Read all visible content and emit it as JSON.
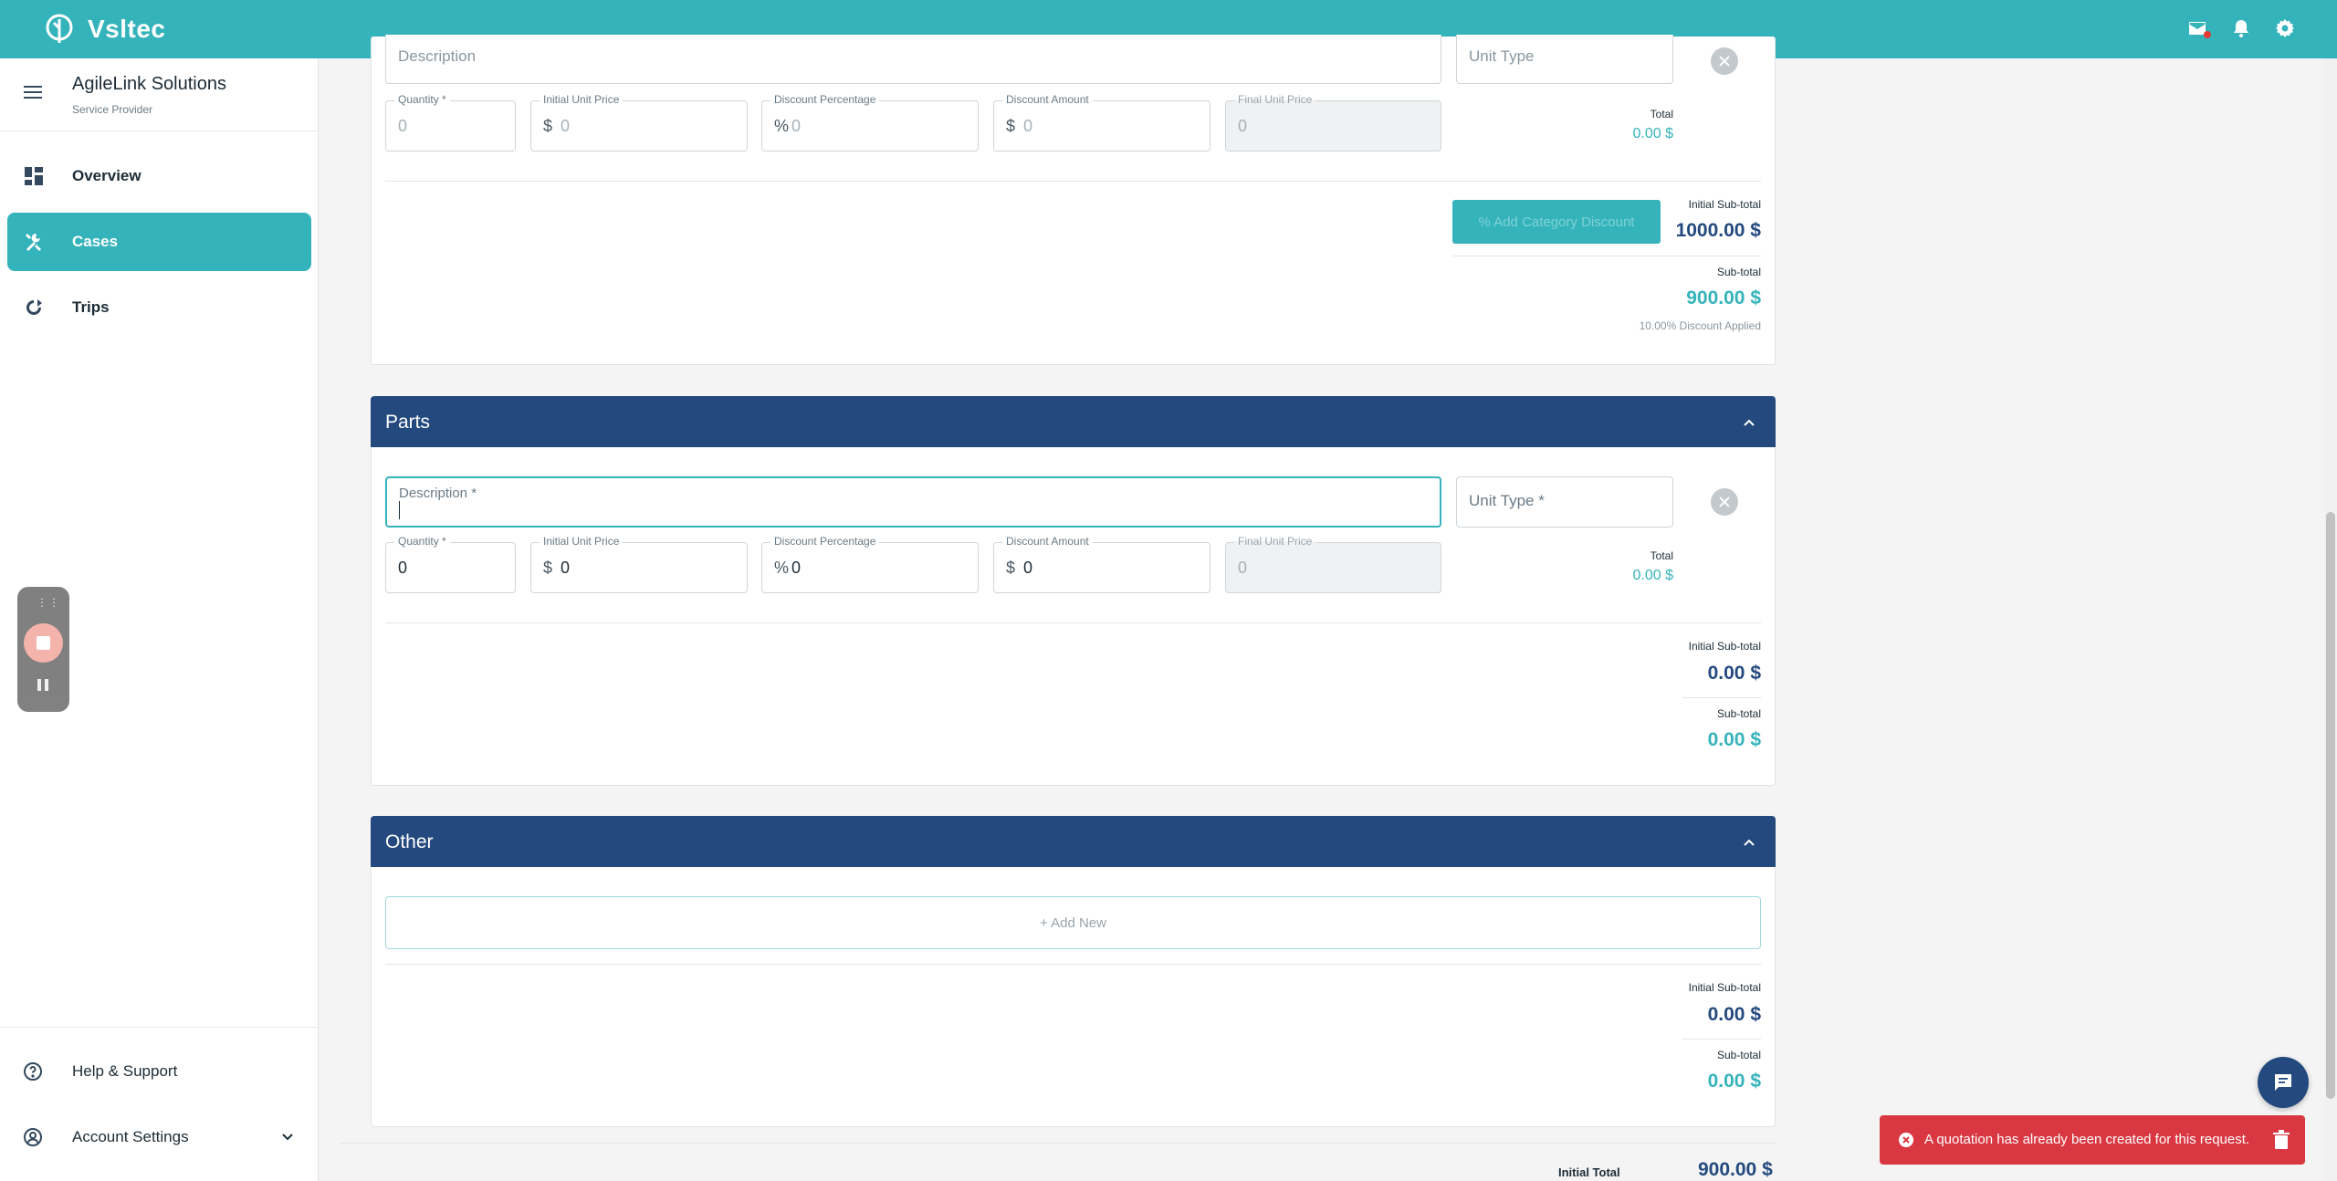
{
  "app": {
    "brand": "Vsltec"
  },
  "topbar": {
    "icons": [
      "mail-icon",
      "bell-icon",
      "gear-icon"
    ],
    "accent": "#35b3bb"
  },
  "sidebar": {
    "org_name": "AgileLink Solutions",
    "org_type": "Service Provider",
    "items": [
      {
        "label": "Overview",
        "icon": "dashboard-icon",
        "active": false
      },
      {
        "label": "Cases",
        "icon": "tools-icon",
        "active": true
      },
      {
        "label": "Trips",
        "icon": "route-icon",
        "active": false
      }
    ],
    "bottom": [
      {
        "label": "Help & Support",
        "icon": "help-icon"
      },
      {
        "label": "Account Settings",
        "icon": "account-icon"
      }
    ]
  },
  "labor": {
    "description_label": "Description",
    "unit_type_label": "Unit Type",
    "quantity_label": "Quantity *",
    "quantity_value": "0",
    "initial_unit_price_label": "Initial Unit Price",
    "initial_unit_price_value": "0",
    "discount_percentage_label": "Discount Percentage",
    "discount_percentage_value": "0",
    "discount_amount_label": "Discount Amount",
    "discount_amount_value": "0",
    "final_unit_price_label": "Final Unit Price",
    "final_unit_price_value": "0",
    "total_label": "Total",
    "total_value": "0.00 $",
    "category_discount_button": "% Add Category Discount",
    "initial_subtotal_label": "Initial Sub-total",
    "initial_subtotal_value": "1000.00 $",
    "subtotal_label": "Sub-total",
    "subtotal_value": "900.00 $",
    "discount_note": "10.00% Discount Applied"
  },
  "parts": {
    "title": "Parts",
    "description_label": "Description *",
    "unit_type_label": "Unit Type *",
    "quantity_label": "Quantity *",
    "quantity_value": "0",
    "initial_unit_price_label": "Initial Unit Price",
    "initial_unit_price_value": "0",
    "discount_percentage_label": "Discount Percentage",
    "discount_percentage_value": "0",
    "discount_amount_label": "Discount Amount",
    "discount_amount_value": "0",
    "final_unit_price_label": "Final Unit Price",
    "final_unit_price_value": "0",
    "total_label": "Total",
    "total_value": "0.00 $",
    "initial_subtotal_label": "Initial Sub-total",
    "initial_subtotal_value": "0.00 $",
    "subtotal_label": "Sub-total",
    "subtotal_value": "0.00 $"
  },
  "other": {
    "title": "Other",
    "add_new": "+ Add New",
    "initial_subtotal_label": "Initial Sub-total",
    "initial_subtotal_value": "0.00 $",
    "subtotal_label": "Sub-total",
    "subtotal_value": "0.00 $"
  },
  "currency_prefix": "$",
  "percent_prefix": "%",
  "grand": {
    "label": "Initial Total",
    "value": "900.00 $"
  },
  "toast": {
    "message": "A quotation has already been created for this request."
  },
  "recorder": {
    "handle": "⋮⋮"
  }
}
